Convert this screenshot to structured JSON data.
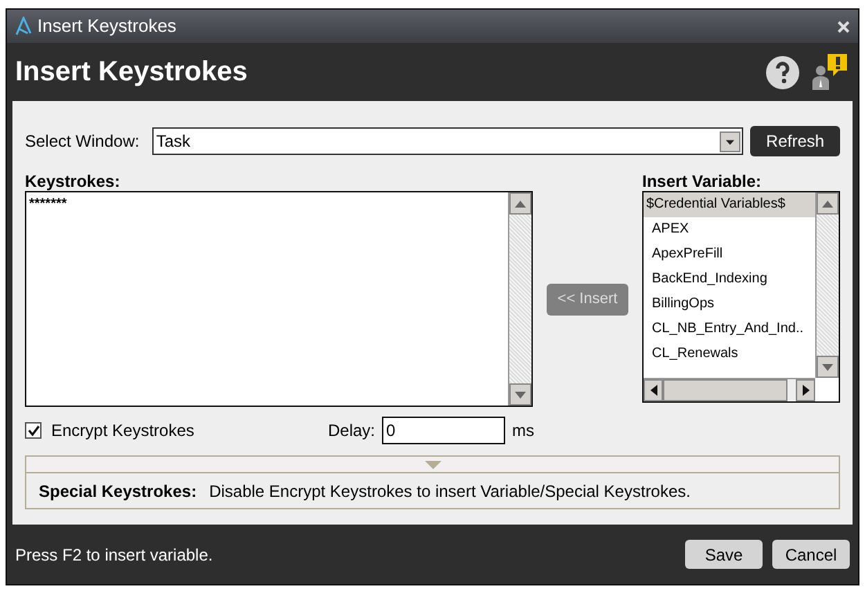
{
  "window": {
    "title": "Insert Keystrokes"
  },
  "header": {
    "title": "Insert Keystrokes"
  },
  "select_window": {
    "label": "Select Window:",
    "value": "Task",
    "refresh_button": "Refresh"
  },
  "keystrokes": {
    "label": "Keystrokes:",
    "value": "*******"
  },
  "insert_button": {
    "label": "<< Insert",
    "disabled": true
  },
  "insert_variable": {
    "label": "Insert Variable:",
    "items": [
      {
        "label": "$Credential Variables$",
        "selected": true
      },
      {
        "label": "APEX",
        "selected": false
      },
      {
        "label": "ApexPreFill",
        "selected": false
      },
      {
        "label": "BackEnd_Indexing",
        "selected": false
      },
      {
        "label": "BillingOps",
        "selected": false
      },
      {
        "label": "CL_NB_Entry_And_Ind..",
        "selected": false
      },
      {
        "label": "CL_Renewals",
        "selected": false
      }
    ]
  },
  "encrypt": {
    "label": "Encrypt Keystrokes",
    "checked": true
  },
  "delay": {
    "label": "Delay:",
    "value": "0",
    "unit": "ms"
  },
  "special": {
    "label": "Special Keystrokes:",
    "message": "Disable Encrypt Keystrokes to insert Variable/Special Keystrokes."
  },
  "status": "Press F2 to insert variable.",
  "buttons": [
    "Save",
    "Cancel"
  ]
}
